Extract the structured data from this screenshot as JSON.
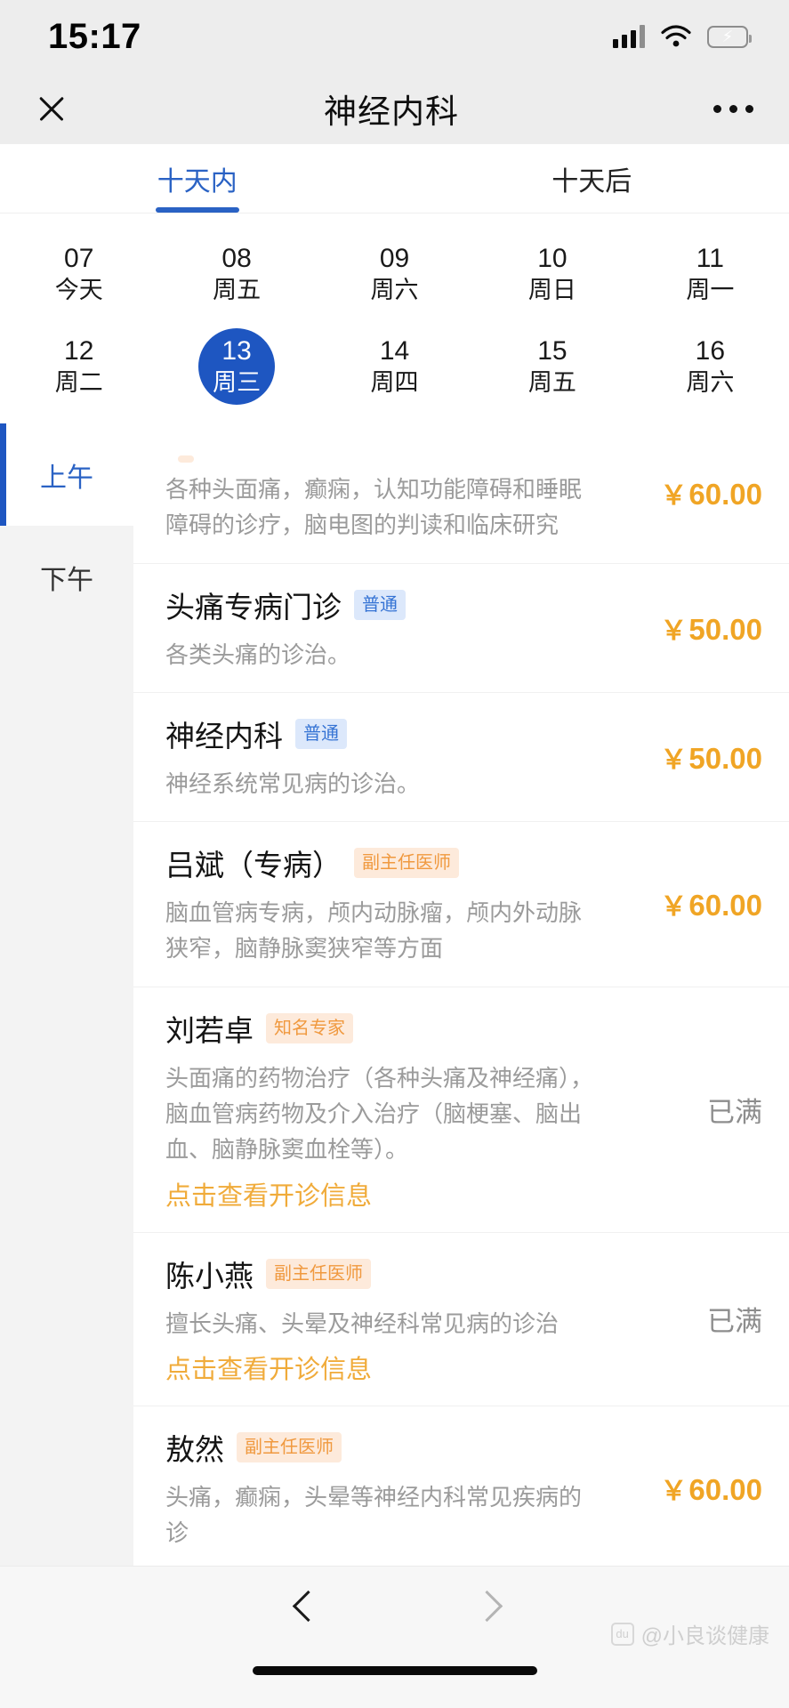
{
  "status_bar": {
    "time": "15:17",
    "signal_icon": "signal-bars-icon",
    "wifi_icon": "wifi-icon",
    "battery_icon": "battery-charging-icon"
  },
  "nav": {
    "close_icon": "close-icon",
    "title": "神经内科",
    "more_icon": "more-options-icon"
  },
  "tabs": [
    {
      "label": "十天内",
      "active": true
    },
    {
      "label": "十天后",
      "active": false
    }
  ],
  "accent_blue": "#2a62c4",
  "accent_orange": "#f0a525",
  "date_rows": [
    [
      {
        "day": "07",
        "weekday": "今天",
        "selected": false
      },
      {
        "day": "08",
        "weekday": "周五",
        "selected": false
      },
      {
        "day": "09",
        "weekday": "周六",
        "selected": false
      },
      {
        "day": "10",
        "weekday": "周日",
        "selected": false
      },
      {
        "day": "11",
        "weekday": "周一",
        "selected": false
      }
    ],
    [
      {
        "day": "12",
        "weekday": "周二",
        "selected": false
      },
      {
        "day": "13",
        "weekday": "周三",
        "selected": true
      },
      {
        "day": "14",
        "weekday": "周四",
        "selected": false
      },
      {
        "day": "15",
        "weekday": "周五",
        "selected": false
      },
      {
        "day": "16",
        "weekday": "周六",
        "selected": false
      }
    ]
  ],
  "sidebar": [
    {
      "label": "上午",
      "active": true
    },
    {
      "label": "下午",
      "active": false
    }
  ],
  "list": [
    {
      "name": "",
      "badge": "",
      "badge_style": "orange",
      "desc": "各种头面痛，癫痫，认知功能障碍和睡眠障碍的诊疗，脑电图的判读和临床研究",
      "price": "60.00",
      "currency": "￥",
      "status": "",
      "link": "",
      "clipped": true
    },
    {
      "name": "头痛专病门诊",
      "badge": "普通",
      "badge_style": "blue",
      "desc": "各类头痛的诊治。",
      "price": "50.00",
      "currency": "￥",
      "status": "",
      "link": "",
      "clipped": false
    },
    {
      "name": "神经内科",
      "badge": "普通",
      "badge_style": "blue",
      "desc": "神经系统常见病的诊治。",
      "price": "50.00",
      "currency": "￥",
      "status": "",
      "link": "",
      "clipped": false
    },
    {
      "name": "吕斌（专病）",
      "badge": "副主任医师",
      "badge_style": "orange",
      "desc": "脑血管病专病，颅内动脉瘤，颅内外动脉狭窄，脑静脉窦狭窄等方面",
      "price": "60.00",
      "currency": "￥",
      "status": "",
      "link": "",
      "clipped": false
    },
    {
      "name": "刘若卓",
      "badge": "知名专家",
      "badge_style": "orange",
      "desc": "头面痛的药物治疗（各种头痛及神经痛），脑血管病药物及介入治疗（脑梗塞、脑出血、脑静脉窦血栓等）。",
      "price": "",
      "currency": "",
      "status": "已满",
      "link": "点击查看开诊信息",
      "clipped": false
    },
    {
      "name": "陈小燕",
      "badge": "副主任医师",
      "badge_style": "orange",
      "desc": "擅长头痛、头晕及神经科常见病的诊治",
      "price": "",
      "currency": "",
      "status": "已满",
      "link": "点击查看开诊信息",
      "clipped": false
    },
    {
      "name": "敖然",
      "badge": "副主任医师",
      "badge_style": "orange",
      "desc": "头痛，癫痫，头晕等神经内科常见疾病的诊",
      "price": "60.00",
      "currency": "￥",
      "status": "",
      "link": "",
      "clipped": false
    }
  ],
  "bottom_bar": {
    "back_icon": "chevron-left-icon",
    "forward_icon": "chevron-right-icon",
    "home_indicator": "home-indicator"
  },
  "watermark": {
    "logo": "du",
    "text": "@小良谈健康"
  }
}
